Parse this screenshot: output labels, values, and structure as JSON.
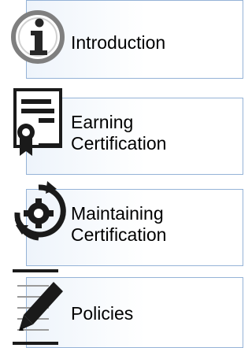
{
  "nav": {
    "items": [
      {
        "label": "Introduction",
        "icon": "info-icon"
      },
      {
        "label": "Earning\nCertification",
        "icon": "certificate-icon"
      },
      {
        "label": "Maintaining\nCertification",
        "icon": "gear-cycle-icon"
      },
      {
        "label": "Policies",
        "icon": "pencil-document-icon"
      }
    ]
  },
  "colors": {
    "border": "#95b3d7",
    "box_fill": "#eef4fb",
    "icon_dark": "#1a1a1a",
    "icon_gray": "#7f7f7f"
  }
}
